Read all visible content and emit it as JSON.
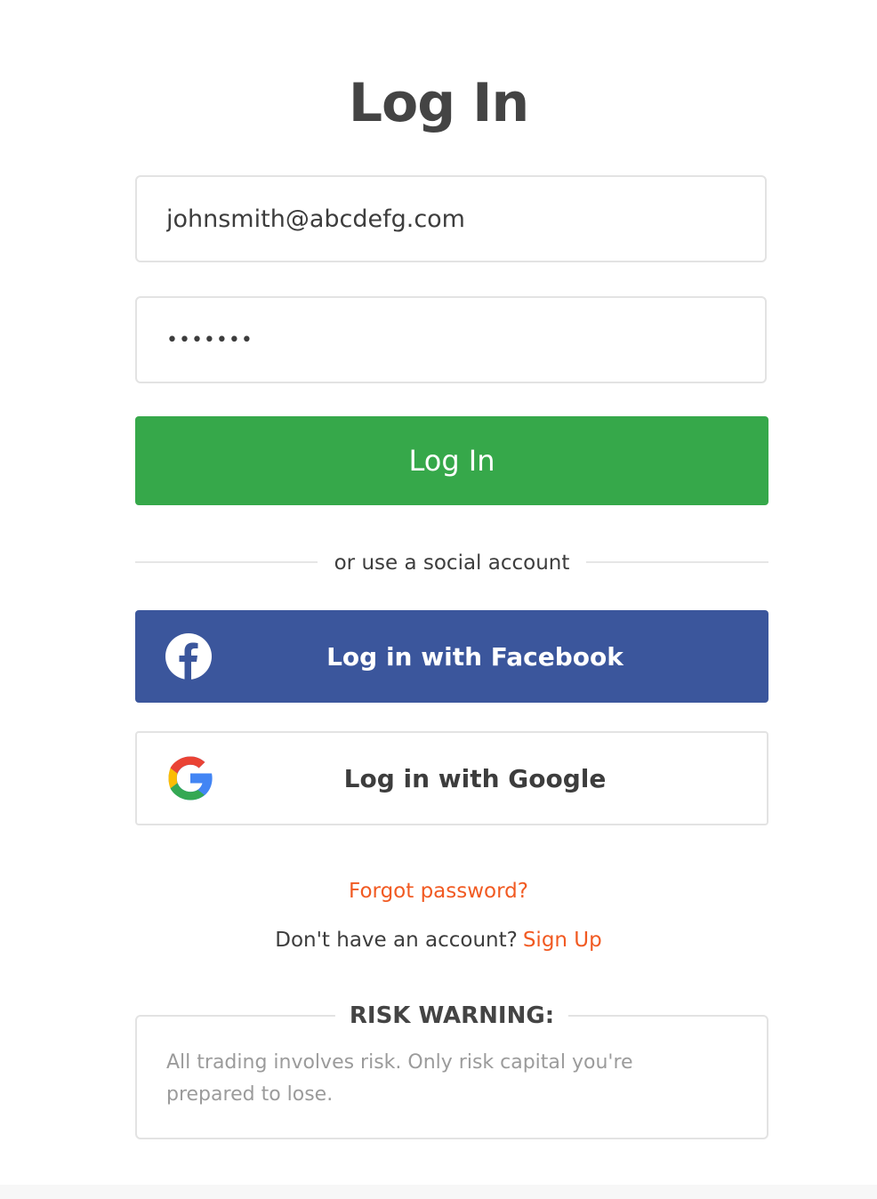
{
  "page": {
    "title": "Log In"
  },
  "form": {
    "email_value": "johnsmith@abcdefg.com",
    "password_value": "•••••••",
    "login_label": "Log In"
  },
  "social": {
    "divider_text": "or use a social account",
    "facebook_label": "Log in with Facebook",
    "google_label": "Log in with Google",
    "facebook_icon": "facebook-icon",
    "google_icon": "google-icon"
  },
  "links": {
    "forgot_password": "Forgot password?",
    "no_account_text": "Don't have an account?",
    "sign_up": "Sign Up"
  },
  "risk": {
    "title": "RISK WARNING:",
    "text": "All trading involves risk. Only risk capital you're prepared to lose."
  },
  "colors": {
    "login_green": "#36a84a",
    "facebook_blue": "#3b569c",
    "link_orange": "#f15a22"
  }
}
